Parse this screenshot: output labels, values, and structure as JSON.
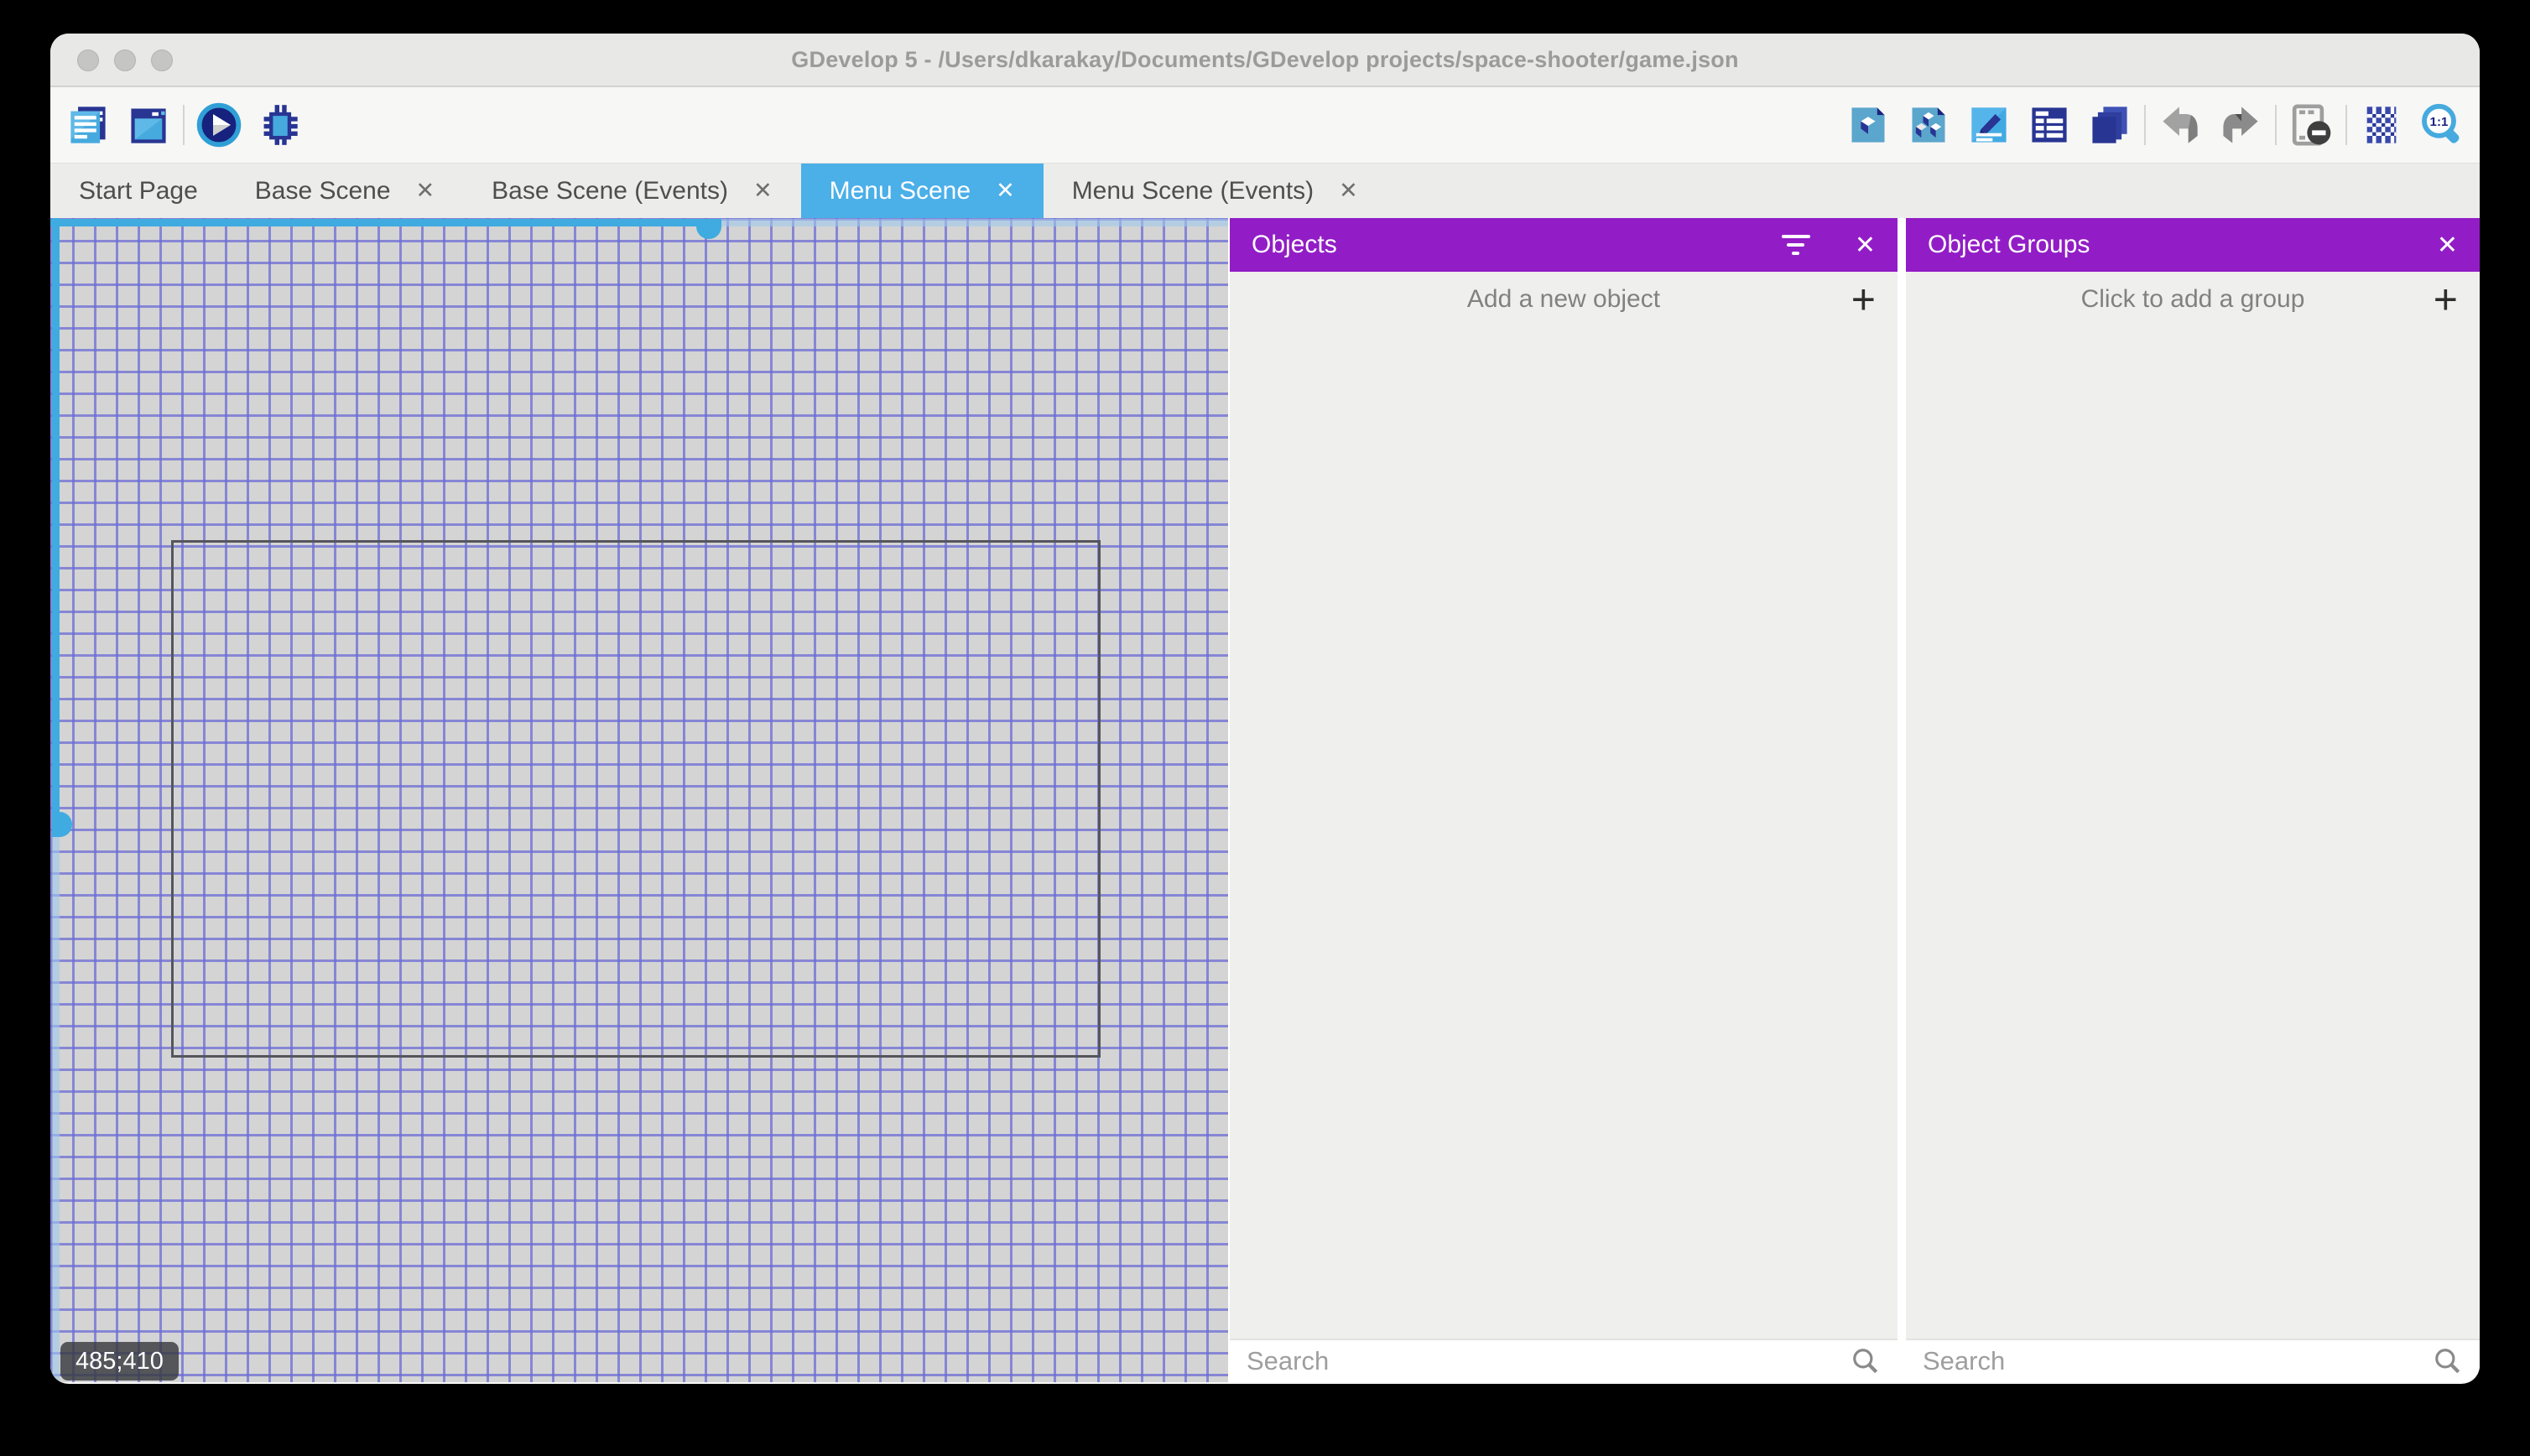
{
  "window_title": "GDevelop 5 - /Users/dkarakay/Documents/GDevelop projects/space-shooter/game.json",
  "titlebar": {
    "controls": [
      "close",
      "minimize",
      "maximize"
    ]
  },
  "toolbar": {
    "left_icons": [
      "project-manager-icon",
      "scene-window-icon",
      "preview-play-icon",
      "debug-icon"
    ],
    "right_icons": [
      "objects-editor-icon",
      "object-groups-editor-icon",
      "properties-icon",
      "instances-list-icon",
      "layers-icon",
      "undo-icon",
      "redo-icon",
      "window-mask-icon",
      "grid-icon",
      "zoom-icon"
    ],
    "zoom_ratio": "1:1"
  },
  "tabs": [
    {
      "label": "Start Page",
      "closable": false,
      "active": false
    },
    {
      "label": "Base Scene",
      "closable": true,
      "active": false
    },
    {
      "label": "Base Scene (Events)",
      "closable": true,
      "active": false
    },
    {
      "label": "Menu Scene",
      "closable": true,
      "active": true
    },
    {
      "label": "Menu Scene (Events)",
      "closable": true,
      "active": false
    }
  ],
  "canvas": {
    "cursor_coordinates": "485;410"
  },
  "panels": {
    "objects": {
      "title": "Objects",
      "add_button": "Add a new object",
      "search_placeholder": "Search"
    },
    "object_groups": {
      "title": "Object Groups",
      "add_button": "Click to add a group",
      "search_placeholder": "Search"
    }
  },
  "glyphs": {
    "close": "✕",
    "plus": "+"
  },
  "colors": {
    "active_tab_blue": "#4bafe8",
    "panel_header_purple": "#921dc6",
    "scrollbar_blue": "#3fabe0",
    "grid_line": "#6c6cd6",
    "canvas_background": "#d4d4d4"
  }
}
